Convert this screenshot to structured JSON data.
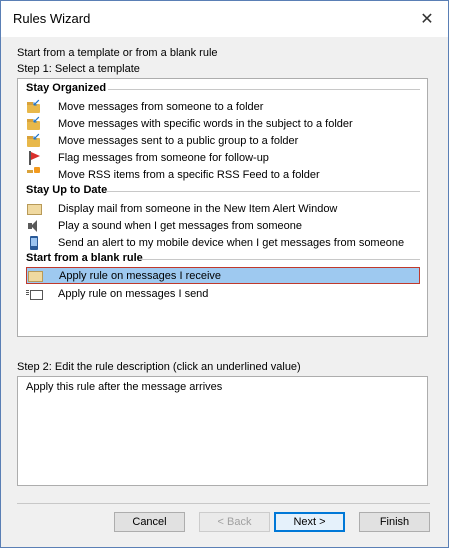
{
  "window": {
    "title": "Rules Wizard",
    "close_glyph": "✕"
  },
  "intro": "Start from a template or from a blank rule",
  "step1_label": "Step 1: Select a template",
  "groups": [
    {
      "name": "Stay Organized",
      "items": [
        {
          "label": "Move messages from someone to a folder",
          "icon": "folder-arrow-icon"
        },
        {
          "label": "Move messages with specific words in the subject to a folder",
          "icon": "folder-arrow-icon"
        },
        {
          "label": "Move messages sent to a public group to a folder",
          "icon": "folder-arrow-icon"
        },
        {
          "label": "Flag messages from someone for follow-up",
          "icon": "flag-icon"
        },
        {
          "label": "Move RSS items from a specific RSS Feed to a folder",
          "icon": "rss-folder-icon"
        }
      ]
    },
    {
      "name": "Stay Up to Date",
      "items": [
        {
          "label": "Display mail from someone in the New Item Alert Window",
          "icon": "envelope-icon"
        },
        {
          "label": "Play a sound when I get messages from someone",
          "icon": "speaker-icon"
        },
        {
          "label": "Send an alert to my mobile device when I get messages from someone",
          "icon": "mobile-icon"
        }
      ]
    },
    {
      "name": "Start from a blank rule",
      "items": [
        {
          "label": "Apply rule on messages I receive",
          "icon": "envelope-icon",
          "selected": true
        },
        {
          "label": "Apply rule on messages I send",
          "icon": "send-icon"
        }
      ]
    }
  ],
  "step2_label": "Step 2: Edit the rule description (click an underlined value)",
  "description": "Apply this rule after the message arrives",
  "buttons": {
    "cancel": "Cancel",
    "back": "< Back",
    "next": "Next >",
    "finish": "Finish"
  },
  "colors": {
    "selection_bg": "#9ec9f0",
    "selection_border": "#c0392b",
    "default_button_border": "#0078d7"
  }
}
